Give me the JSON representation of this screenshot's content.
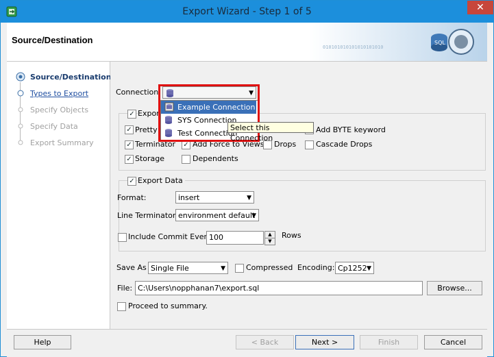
{
  "window": {
    "title": "Export Wizard - Step 1 of 5",
    "close": "✕"
  },
  "header": {
    "title": "Source/Destination",
    "art_binary": "010101010101010101010",
    "art_label": "SQL"
  },
  "steps": [
    {
      "label": "Source/Destination",
      "state": "current"
    },
    {
      "label": "Types to Export",
      "state": "link"
    },
    {
      "label": "Specify Objects",
      "state": "disabled"
    },
    {
      "label": "Specify Data",
      "state": "disabled"
    },
    {
      "label": "Export Summary",
      "state": "disabled"
    }
  ],
  "connection": {
    "label": "Connection:",
    "options": [
      "Example Connection",
      "SYS Connection",
      "Test Connection"
    ],
    "highlighted": "Example Connection",
    "tooltip": "Select this Connection"
  },
  "export_ddl": {
    "label": "Export",
    "pretty": "Pretty",
    "add_byte": "Add BYTE keyword",
    "terminator": "Terminator",
    "add_force": "Add Force to Views",
    "drops": "Drops",
    "cascade_drops": "Cascade Drops",
    "storage": "Storage",
    "dependents": "Dependents"
  },
  "export_data": {
    "label": "Export Data",
    "format_label": "Format:",
    "format_value": "insert",
    "line_term_label": "Line Terminator:",
    "line_term_value": "environment default",
    "commit_label": "Include Commit Every",
    "commit_value": "100",
    "rows_label": "Rows"
  },
  "save": {
    "save_as_label": "Save As",
    "save_as_value": "Single File",
    "compressed": "Compressed",
    "encoding_label": "Encoding:",
    "encoding_value": "Cp1252",
    "file_label": "File:",
    "file_value": "C:\\Users\\nopphanan7\\export.sql",
    "browse": "Browse...",
    "proceed": "Proceed to summary."
  },
  "footer": {
    "help": "Help",
    "back": "< Back",
    "next": "Next >",
    "finish": "Finish",
    "cancel": "Cancel"
  },
  "colors": {
    "titlebar": "#1c8fdc",
    "selection": "#3a70b8",
    "highlight_frame": "#e01010",
    "close": "#c7463b"
  }
}
